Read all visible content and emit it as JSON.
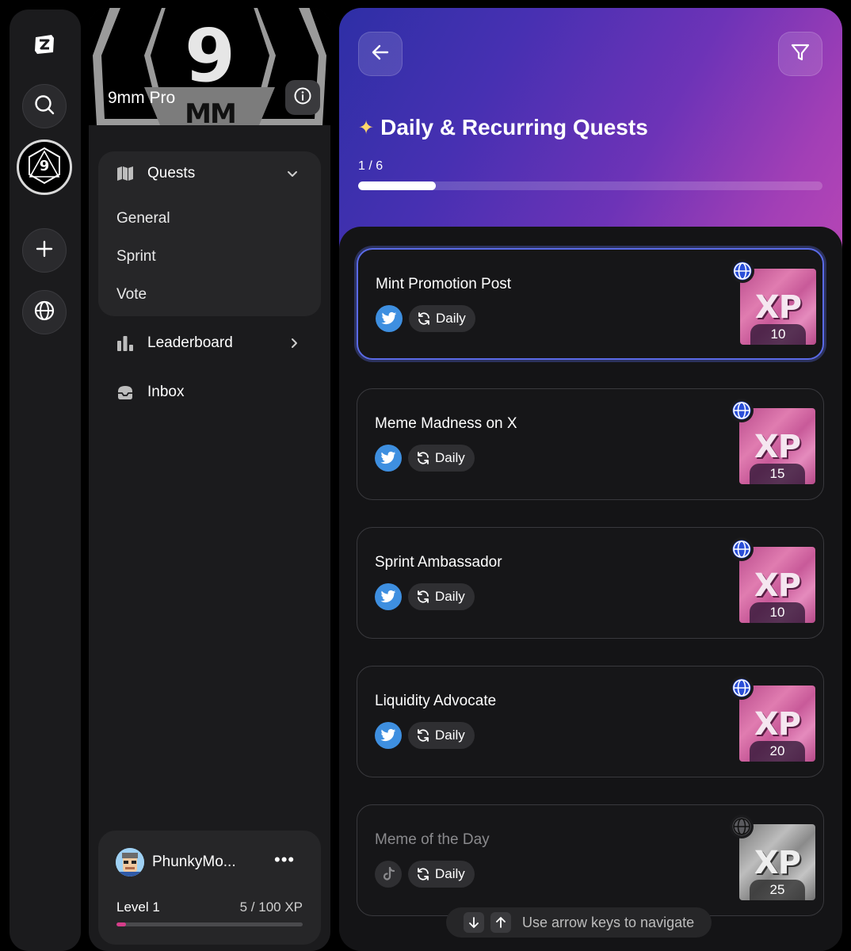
{
  "project": {
    "name": "9mm Pro"
  },
  "sidebar": {
    "quests_label": "Quests",
    "quest_items": [
      "General",
      "Sprint",
      "Vote"
    ],
    "leaderboard_label": "Leaderboard",
    "inbox_label": "Inbox"
  },
  "user": {
    "name": "PhunkyMo...",
    "more_label": "•••",
    "level_label": "Level 1",
    "xp_label": "5 / 100 XP",
    "level_progress": 0.05
  },
  "main": {
    "title": "Daily & Recurring Quests",
    "title_icon": "star-icon",
    "progress_label": "1 / 6",
    "progress": 0.1667,
    "quests": [
      {
        "title": "Mint Promotion Post",
        "platform": "twitter-icon",
        "frequency": "Daily",
        "xp": "10",
        "selected": true,
        "disabled": false
      },
      {
        "title": "Meme Madness on X",
        "platform": "twitter-icon",
        "frequency": "Daily",
        "xp": "15",
        "selected": false,
        "disabled": false
      },
      {
        "title": "Sprint Ambassador",
        "platform": "twitter-icon",
        "frequency": "Daily",
        "xp": "10",
        "selected": false,
        "disabled": false
      },
      {
        "title": "Liquidity Advocate",
        "platform": "twitter-icon",
        "frequency": "Daily",
        "xp": "20",
        "selected": false,
        "disabled": false
      },
      {
        "title": "Meme of the Day",
        "platform": "tiktok-icon",
        "frequency": "Daily",
        "xp": "25",
        "selected": false,
        "disabled": true
      }
    ],
    "xp_badge_text": "XP",
    "hint": "Use arrow keys to navigate"
  },
  "colors": {
    "accent": "#5a6ae6",
    "level_fill": "#d63d8a",
    "twitter": "#3e8fe0"
  }
}
